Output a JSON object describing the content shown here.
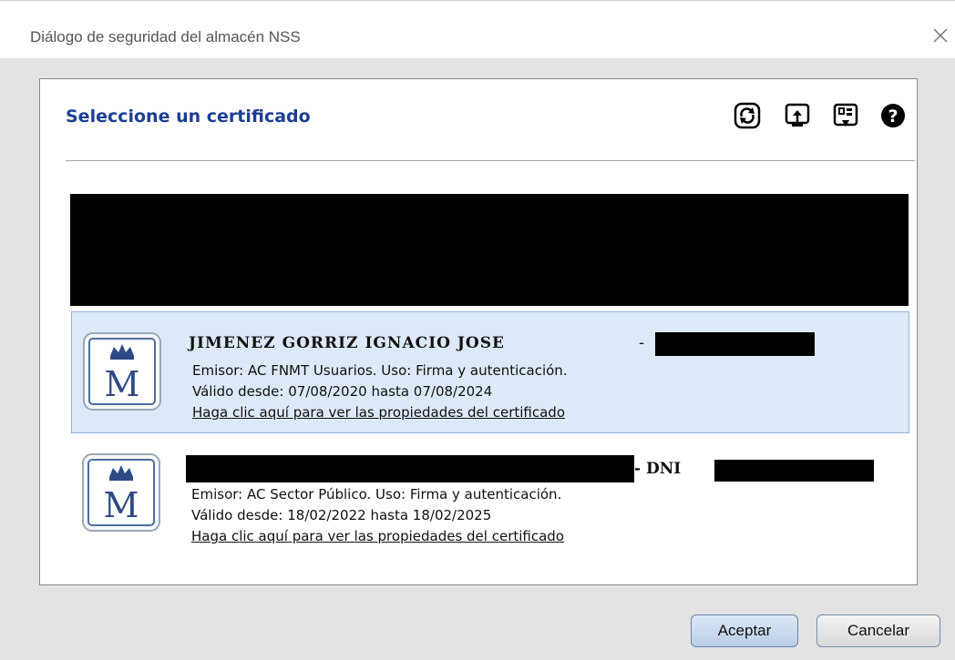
{
  "window": {
    "title": "Diálogo de seguridad del almacén NSS"
  },
  "panel": {
    "title": "Seleccione un certificado"
  },
  "toolbar": {
    "icons": [
      "refresh-icon",
      "import-icon",
      "export-icon",
      "help-icon"
    ]
  },
  "certificates": [
    {
      "name": "JIMENEZ GORRIZ IGNACIO JOSE",
      "separator": "-",
      "issuer": "Emisor: AC FNMT Usuarios. Uso: Firma y autenticación.",
      "validity": "Válido desde: 07/08/2020 hasta 07/08/2024",
      "link": "Haga clic aquí para ver las propiedades del certificado",
      "selected": true
    },
    {
      "name": "- DNI",
      "issuer": "Emisor: AC Sector Público. Uso: Firma y autenticación.",
      "validity": "Válido desde: 18/02/2022 hasta 18/02/2025",
      "link": "Haga clic aquí para ver las propiedades del certificado",
      "selected": false
    }
  ],
  "buttons": {
    "accept": "Aceptar",
    "cancel": "Cancelar"
  },
  "colors": {
    "title_blue": "#1c3f94",
    "selection_bg": "#dde9f8",
    "dialog_bg": "#e3e3e3"
  }
}
